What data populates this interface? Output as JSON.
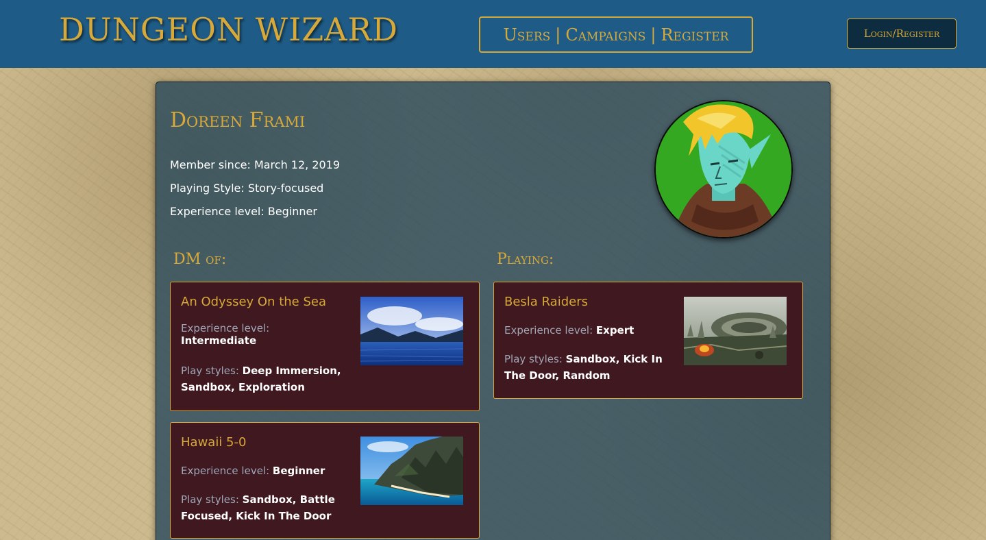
{
  "header": {
    "logo": "DUNGEON WIZARD",
    "nav": [
      {
        "label": "Users"
      },
      {
        "label": "Campaigns"
      },
      {
        "label": "Register"
      }
    ],
    "nav_separator": "|",
    "login_label": "Login/Register"
  },
  "profile": {
    "name": "Doreen Frami",
    "member_since": "Member since: March 12, 2019",
    "playing_style": "Playing Style: Story-focused",
    "experience": "Experience level: Beginner",
    "dm_of_title": "DM of:",
    "playing_title": "Playing:"
  },
  "dm_campaigns": [
    {
      "title": "An Odyssey On the Sea",
      "experience_label": "Experience level:",
      "experience_value": "Intermediate",
      "styles_label": "Play styles:",
      "styles_value": "Deep Immersion, Sandbox, Exploration",
      "image": "lake-mountains-image"
    },
    {
      "title": "Hawaii 5-0",
      "experience_label": "Experience level:",
      "experience_value": "Beginner",
      "styles_label": "Play styles:",
      "styles_value": "Sandbox, Battle Focused, Kick In The Door",
      "image": "coastal-cliffs-image"
    }
  ],
  "playing_campaigns": [
    {
      "title": "Besla Raiders",
      "experience_label": "Experience level:",
      "experience_value": "Expert",
      "styles_label": "Play styles:",
      "styles_value": "Sandbox, Kick In The Door, Random",
      "image": "ruined-city-image"
    }
  ],
  "colors": {
    "header_bg": "#1e5b86",
    "accent_gold": "#d7a93a",
    "card_bg": "#401820",
    "profile_bg": "#28485c"
  }
}
